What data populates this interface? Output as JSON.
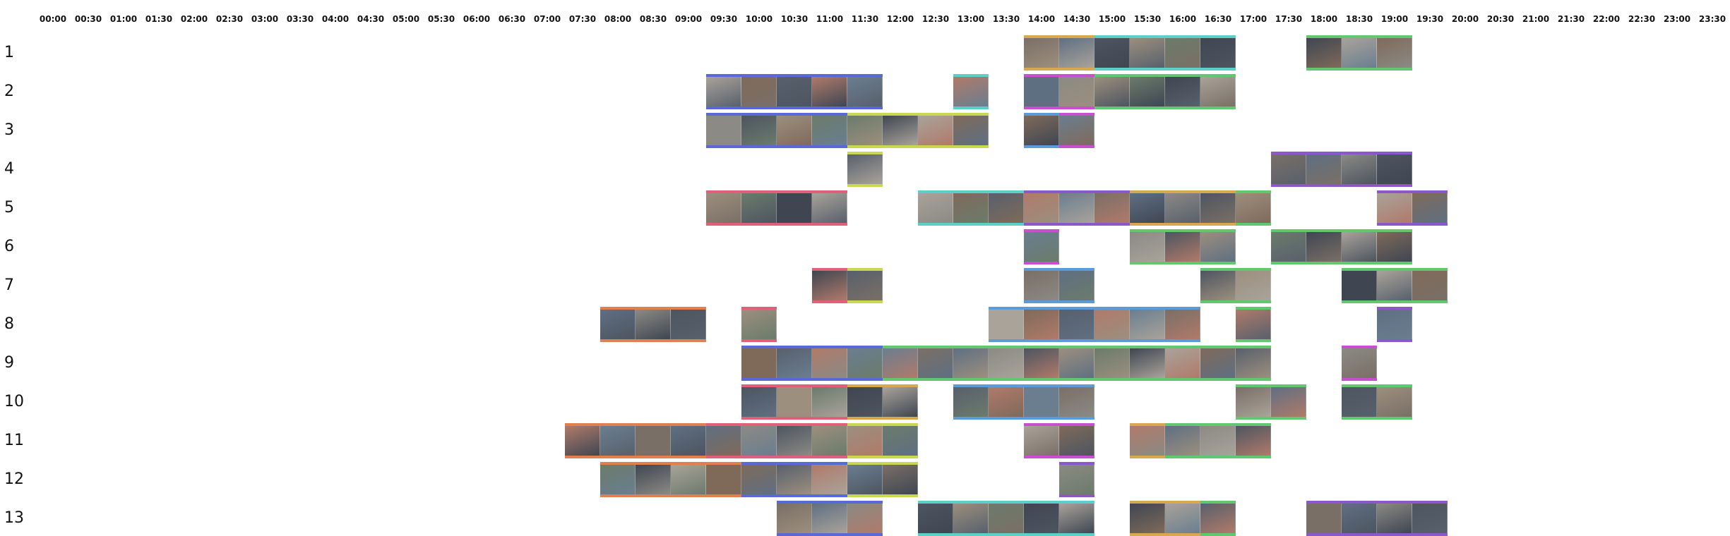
{
  "time_labels": [
    "00:00",
    "00:30",
    "01:00",
    "01:30",
    "02:00",
    "02:30",
    "03:00",
    "03:30",
    "04:00",
    "04:30",
    "05:00",
    "05:30",
    "06:00",
    "06:30",
    "07:00",
    "07:30",
    "08:00",
    "08:30",
    "09:00",
    "09:30",
    "10:00",
    "10:30",
    "11:00",
    "11:30",
    "12:00",
    "12:30",
    "13:00",
    "13:30",
    "14:00",
    "14:30",
    "15:00",
    "15:30",
    "16:00",
    "16:30",
    "17:00",
    "17:30",
    "18:00",
    "18:30",
    "19:00",
    "19:30",
    "20:00",
    "20:30",
    "21:00",
    "21:30",
    "22:00",
    "22:30",
    "23:00",
    "23:30"
  ],
  "colors": {
    "orange": "#e07f50",
    "rose": "#e0607a",
    "blue": "#5a68d8",
    "sky": "#5c9ad8",
    "teal": "#5ccfc8",
    "lime": "#c8d850",
    "green": "#62c870",
    "purple": "#8a58c8",
    "magenta": "#c850d0",
    "amber": "#d8a850"
  },
  "thumb_palette": [
    "#7a6f66",
    "#5f6f82",
    "#8b8a84",
    "#4d5560",
    "#9c8f7e",
    "#6b7b6b",
    "#3f4652",
    "#a9a39a",
    "#7f6a5a",
    "#58606c",
    "#b07a6a",
    "#6a7e90"
  ],
  "rows": [
    {
      "label": "1",
      "segments": [
        {
          "start": "14:00",
          "end": "15:00",
          "color": "amber"
        },
        {
          "start": "15:00",
          "end": "17:00",
          "color": "teal"
        },
        {
          "start": "18:00",
          "end": "19:30",
          "color": "green"
        }
      ]
    },
    {
      "label": "2",
      "segments": [
        {
          "start": "09:30",
          "end": "12:00",
          "color": "blue"
        },
        {
          "start": "13:00",
          "end": "13:30",
          "color": "teal"
        },
        {
          "start": "14:00",
          "end": "15:00",
          "color": "magenta"
        },
        {
          "start": "15:00",
          "end": "17:00",
          "color": "green"
        }
      ]
    },
    {
      "label": "3",
      "segments": [
        {
          "start": "09:30",
          "end": "11:30",
          "color": "blue"
        },
        {
          "start": "11:30",
          "end": "13:30",
          "color": "lime"
        },
        {
          "start": "14:00",
          "end": "14:30",
          "color": "sky"
        },
        {
          "start": "14:30",
          "end": "15:00",
          "color": "magenta"
        }
      ]
    },
    {
      "label": "4",
      "segments": [
        {
          "start": "11:30",
          "end": "12:00",
          "color": "lime"
        },
        {
          "start": "17:30",
          "end": "19:30",
          "color": "purple"
        }
      ]
    },
    {
      "label": "5",
      "segments": [
        {
          "start": "09:30",
          "end": "11:30",
          "color": "rose"
        },
        {
          "start": "12:30",
          "end": "14:00",
          "color": "teal"
        },
        {
          "start": "14:00",
          "end": "15:30",
          "color": "purple"
        },
        {
          "start": "15:30",
          "end": "17:00",
          "color": "amber"
        },
        {
          "start": "17:00",
          "end": "17:30",
          "color": "green"
        },
        {
          "start": "19:00",
          "end": "20:00",
          "color": "purple"
        }
      ]
    },
    {
      "label": "6",
      "segments": [
        {
          "start": "14:00",
          "end": "14:30",
          "color": "magenta"
        },
        {
          "start": "15:30",
          "end": "17:00",
          "color": "green"
        },
        {
          "start": "17:30",
          "end": "19:30",
          "color": "green"
        }
      ]
    },
    {
      "label": "7",
      "segments": [
        {
          "start": "11:00",
          "end": "11:30",
          "color": "rose"
        },
        {
          "start": "11:30",
          "end": "12:00",
          "color": "lime"
        },
        {
          "start": "14:00",
          "end": "15:00",
          "color": "sky"
        },
        {
          "start": "16:30",
          "end": "17:30",
          "color": "green"
        },
        {
          "start": "18:30",
          "end": "20:00",
          "color": "green"
        }
      ]
    },
    {
      "label": "8",
      "segments": [
        {
          "start": "08:00",
          "end": "09:30",
          "color": "orange"
        },
        {
          "start": "10:00",
          "end": "10:30",
          "color": "rose"
        },
        {
          "start": "13:30",
          "end": "16:30",
          "color": "sky"
        },
        {
          "start": "17:00",
          "end": "17:30",
          "color": "green"
        },
        {
          "start": "19:00",
          "end": "19:30",
          "color": "purple"
        }
      ]
    },
    {
      "label": "9",
      "segments": [
        {
          "start": "10:00",
          "end": "12:00",
          "color": "blue"
        },
        {
          "start": "12:00",
          "end": "17:30",
          "color": "green"
        },
        {
          "start": "18:30",
          "end": "19:00",
          "color": "magenta"
        }
      ]
    },
    {
      "label": "10",
      "segments": [
        {
          "start": "10:00",
          "end": "11:30",
          "color": "rose"
        },
        {
          "start": "11:30",
          "end": "12:30",
          "color": "amber"
        },
        {
          "start": "13:00",
          "end": "15:00",
          "color": "sky"
        },
        {
          "start": "17:00",
          "end": "18:00",
          "color": "green"
        },
        {
          "start": "18:30",
          "end": "19:30",
          "color": "green"
        }
      ]
    },
    {
      "label": "11",
      "segments": [
        {
          "start": "07:30",
          "end": "09:30",
          "color": "orange"
        },
        {
          "start": "09:30",
          "end": "11:30",
          "color": "rose"
        },
        {
          "start": "11:30",
          "end": "12:30",
          "color": "lime"
        },
        {
          "start": "14:00",
          "end": "15:00",
          "color": "magenta"
        },
        {
          "start": "15:30",
          "end": "16:00",
          "color": "amber"
        },
        {
          "start": "16:00",
          "end": "17:30",
          "color": "green"
        }
      ]
    },
    {
      "label": "12",
      "segments": [
        {
          "start": "08:00",
          "end": "10:00",
          "color": "orange"
        },
        {
          "start": "10:00",
          "end": "11:30",
          "color": "blue"
        },
        {
          "start": "11:30",
          "end": "12:30",
          "color": "lime"
        },
        {
          "start": "14:30",
          "end": "15:00",
          "color": "purple"
        }
      ]
    },
    {
      "label": "13",
      "segments": [
        {
          "start": "10:30",
          "end": "12:00",
          "color": "blue"
        },
        {
          "start": "12:30",
          "end": "15:00",
          "color": "teal"
        },
        {
          "start": "15:30",
          "end": "16:30",
          "color": "amber"
        },
        {
          "start": "16:30",
          "end": "17:00",
          "color": "green"
        },
        {
          "start": "18:00",
          "end": "20:00",
          "color": "purple"
        }
      ]
    }
  ]
}
